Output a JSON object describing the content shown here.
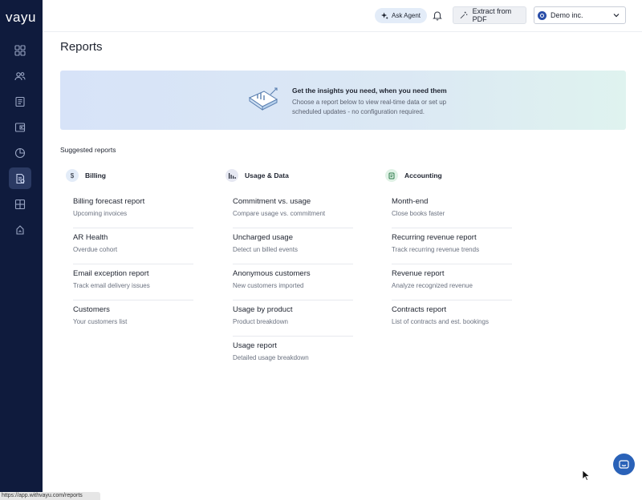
{
  "app": {
    "logo": "vayu"
  },
  "sidebar": {
    "items": [
      {
        "icon": "dashboard-icon"
      },
      {
        "icon": "users-icon"
      },
      {
        "icon": "invoices-icon"
      },
      {
        "icon": "wallet-icon"
      },
      {
        "icon": "pie-chart-icon"
      },
      {
        "icon": "reports-icon",
        "active": true
      },
      {
        "icon": "layout-icon"
      },
      {
        "icon": "integrations-icon"
      }
    ]
  },
  "topbar": {
    "ask_agent": "Ask Agent",
    "extract_pdf": "Extract from PDF",
    "account": "Demo inc."
  },
  "page": {
    "title": "Reports"
  },
  "banner": {
    "title": "Get the insights you need, when you need them",
    "subtitle": "Choose a report below to view real-time data or set up scheduled updates - no configuration required."
  },
  "suggested_label": "Suggested reports",
  "columns": [
    {
      "name": "Billing",
      "badge": "$",
      "badge_color": "#e3ecf8",
      "reports": [
        {
          "title": "Billing forecast report",
          "subtitle": "Upcoming invoices"
        },
        {
          "title": "AR Health",
          "subtitle": "Overdue cohort"
        },
        {
          "title": "Email exception report",
          "subtitle": "Track email delivery issues"
        },
        {
          "title": "Customers",
          "subtitle": "Your customers list"
        }
      ]
    },
    {
      "name": "Usage & Data",
      "badge": "",
      "badge_color": "#e6e8f2",
      "reports": [
        {
          "title": "Commitment vs. usage",
          "subtitle": "Compare usage vs. commitment"
        },
        {
          "title": "Uncharged usage",
          "subtitle": "Detect un billed events"
        },
        {
          "title": "Anonymous customers",
          "subtitle": "New customers imported"
        },
        {
          "title": "Usage by product",
          "subtitle": "Product breakdown"
        },
        {
          "title": "Usage report",
          "subtitle": "Detailed usage breakdown"
        }
      ]
    },
    {
      "name": "Accounting",
      "badge": "",
      "badge_color": "#e0f2e6",
      "reports": [
        {
          "title": "Month-end",
          "subtitle": "Close books faster"
        },
        {
          "title": "Recurring revenue report",
          "subtitle": "Track recurring revenue trends"
        },
        {
          "title": "Revenue report",
          "subtitle": "Analyze recognized revenue"
        },
        {
          "title": "Contracts report",
          "subtitle": "List of contracts and est. bookings"
        }
      ]
    }
  ],
  "status_bar": {
    "url": "https://app.withvayu.com/reports"
  },
  "colors": {
    "sidebar": "#0f1b3d",
    "accent": "#2a62b8"
  }
}
